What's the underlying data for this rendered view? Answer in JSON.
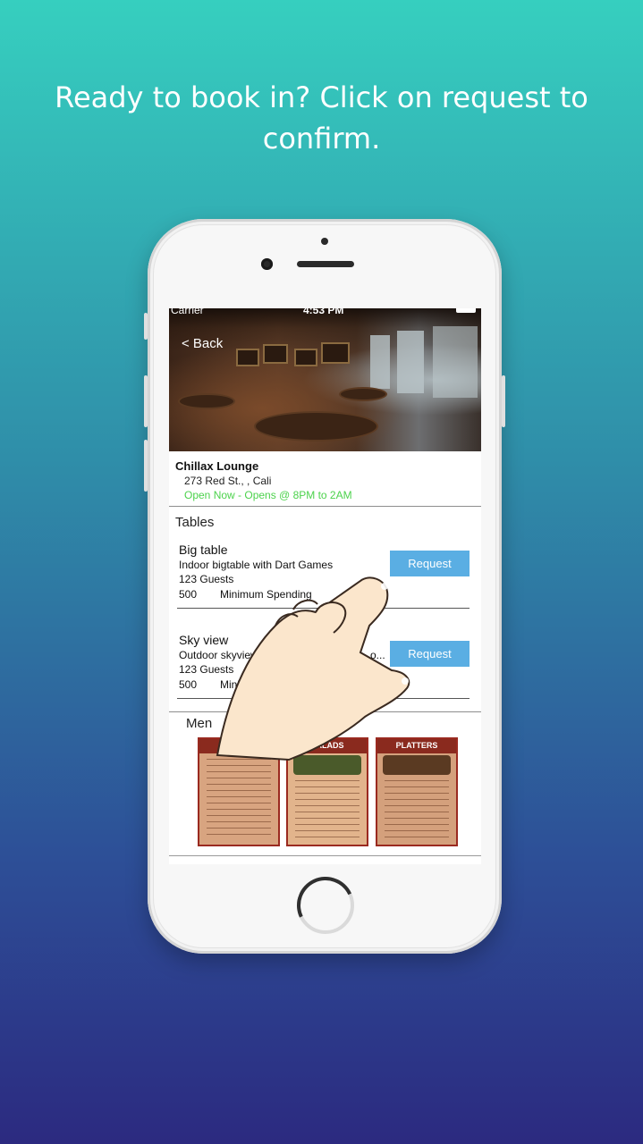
{
  "headline": "Ready to book in? Click on request to confirm.",
  "status_bar": {
    "carrier": "Carrier",
    "time": "4:53 PM"
  },
  "nav": {
    "back_label": "< Back"
  },
  "venue": {
    "name": "Chillax Lounge",
    "address": "273 Red St., , Cali",
    "hours": "Open Now - Opens @ 8PM to 2AM"
  },
  "tables_section": {
    "title": "Tables",
    "items": [
      {
        "name": "Big table",
        "description": "Indoor bigtable with Dart Games",
        "guests": "123  Guests",
        "min_spend_value": "500",
        "min_spend_label": "Minimum Spending",
        "button_label": "Request"
      },
      {
        "name": "Sky view",
        "description": "Outdoor skyview lo",
        "description_tail": "o...",
        "guests": "123  Guests",
        "min_spend_value": "500",
        "min_spend_label": "Minim",
        "button_label": "Request"
      }
    ]
  },
  "menu_section": {
    "title": "Men",
    "images": [
      {
        "heading": "APP SAN",
        "icon": "menu-appetizers-image"
      },
      {
        "heading": "SALADS",
        "subheading": "MADE FRESH EVERY DAY",
        "icon": "menu-salads-image"
      },
      {
        "heading": "PLATTERS",
        "subheading": "WITH FRIES OR RICE",
        "icon": "menu-platters-image"
      }
    ]
  },
  "colors": {
    "request_button": "#5aaee3",
    "open_now": "#4cd24c",
    "gradient_top": "#36cfbf",
    "gradient_bottom": "#2c2a80"
  }
}
